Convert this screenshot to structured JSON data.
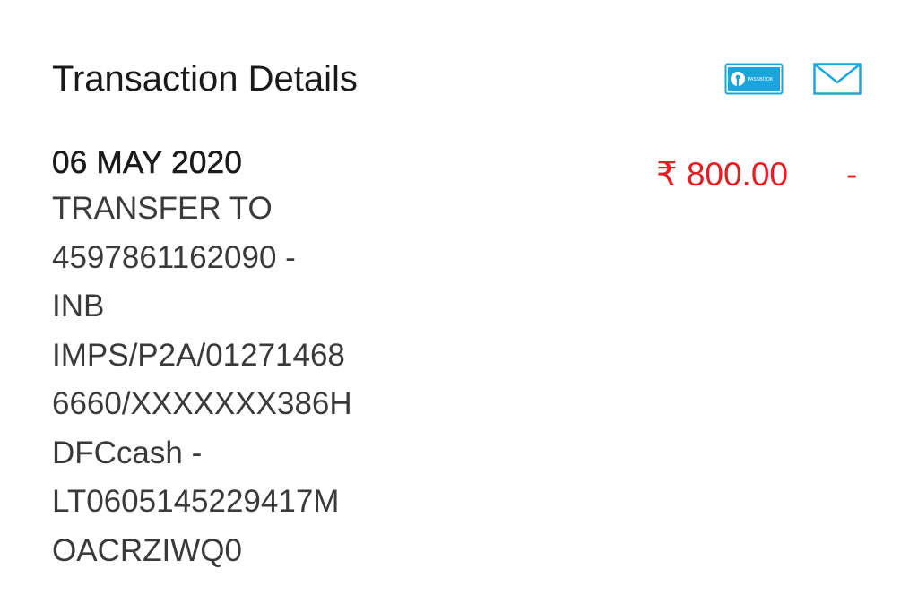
{
  "header": {
    "title": "Transaction Details",
    "passbook_icon_text": "PASSBOOK",
    "accent_color": "#1aa6dc"
  },
  "transaction": {
    "date": "06 MAY 2020",
    "description_lines": [
      "TRANSFER TO",
      "4597861162090 -",
      "INB",
      "IMPS/P2A/01271468",
      "6660/XXXXXXX386H",
      "DFCcash -",
      "LT0605145229417M",
      "OACRZIWQ0"
    ],
    "amount": "₹ 800.00",
    "type_marker": "-",
    "amount_color": "#e31e24"
  }
}
